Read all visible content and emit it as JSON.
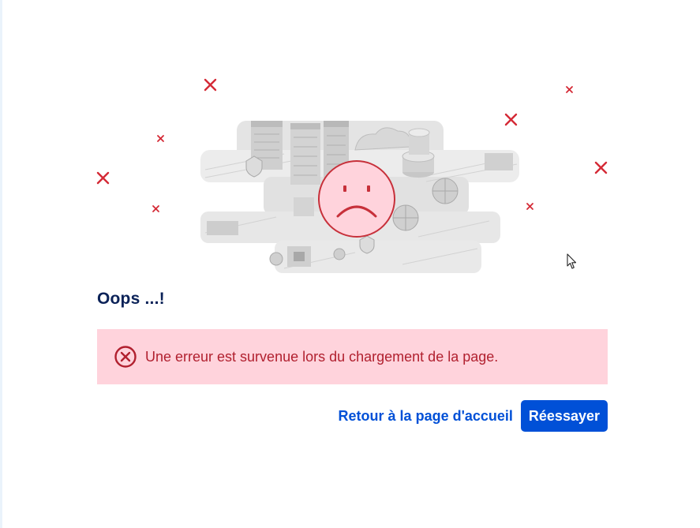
{
  "page": {
    "title": "Oops ...!"
  },
  "error": {
    "message": "Une erreur est survenue lors du chargement de la page.",
    "icon": "circle-x-icon",
    "colors": {
      "background": "#ffd3dc",
      "text": "#b1202f"
    }
  },
  "actions": {
    "home_label": "Retour à la page d'accueil",
    "retry_label": "Réessayer",
    "accent": "#0050d7"
  },
  "illustration": {
    "face": "sad-face-icon",
    "marks": "x-mark-icon",
    "mark_color": "#d42a36"
  },
  "colors": {
    "title": "#0b2258"
  }
}
